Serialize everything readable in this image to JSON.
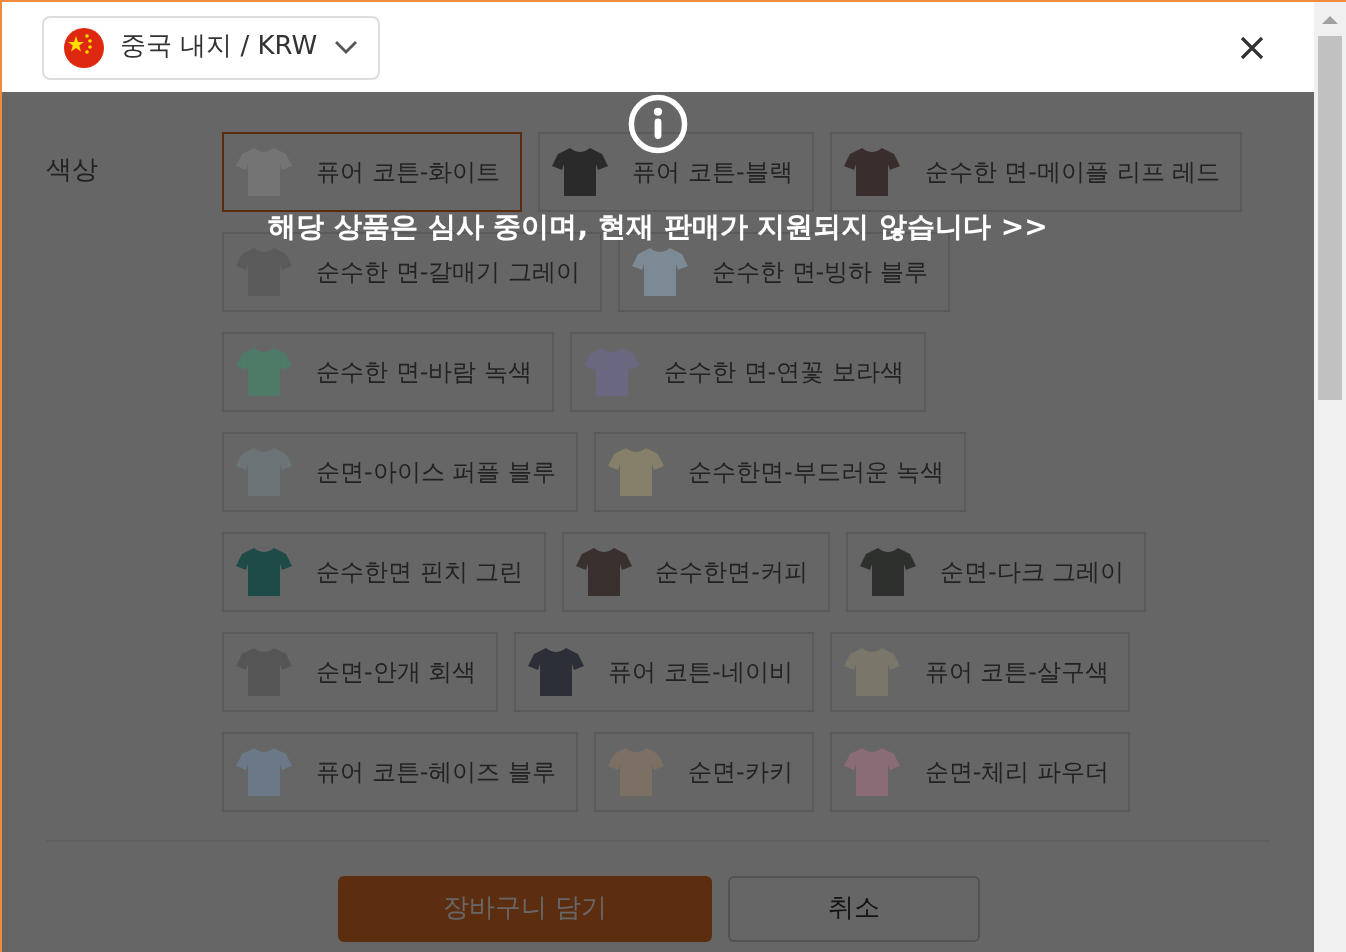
{
  "header": {
    "region_selector": {
      "label": "중국 내지 / KRW"
    }
  },
  "color_option": {
    "label": "색상",
    "swatches": [
      {
        "name": "퓨어 코튼-화이트",
        "color": "#747474",
        "selected": true
      },
      {
        "name": "퓨어 코튼-블랙",
        "color": "#2a2a2a",
        "selected": false
      },
      {
        "name": "순수한 면-메이플 리프 레드",
        "color": "#3a2e2c",
        "selected": false
      },
      {
        "name": "순수한 면-갈매기 그레이",
        "color": "#5a5a5a",
        "selected": false
      },
      {
        "name": "순수한 면-빙하 블루",
        "color": "#7c8a96",
        "selected": false
      },
      {
        "name": "순수한 면-바람 녹색",
        "color": "#4e7a68",
        "selected": false
      },
      {
        "name": "순수한 면-연꽃 보라색",
        "color": "#6a6880",
        "selected": false
      },
      {
        "name": "순면-아이스 퍼플 블루",
        "color": "#6c7478",
        "selected": false
      },
      {
        "name": "순수한면-부드러운 녹색",
        "color": "#86806a",
        "selected": false
      },
      {
        "name": "순수한면 핀치 그린",
        "color": "#1e4a48",
        "selected": false
      },
      {
        "name": "순수한면-커피",
        "color": "#3a302e",
        "selected": false
      },
      {
        "name": "순면-다크 그레이",
        "color": "#2e302e",
        "selected": false
      },
      {
        "name": "순면-안개 회색",
        "color": "#555555",
        "selected": false
      },
      {
        "name": "퓨어 코튼-네이비",
        "color": "#2c2e38",
        "selected": false
      },
      {
        "name": "퓨어 코튼-살구색",
        "color": "#7a766a",
        "selected": false
      },
      {
        "name": "퓨어 코튼-헤이즈 블루",
        "color": "#6a7888",
        "selected": false
      },
      {
        "name": "순면-카키",
        "color": "#7c7064",
        "selected": false
      },
      {
        "name": "순면-체리 파우더",
        "color": "#8a6c76",
        "selected": false
      }
    ]
  },
  "buttons": [
    {
      "label": "장바구니 담기",
      "kind": "primary"
    },
    {
      "label": "취소",
      "kind": "secondary"
    }
  ],
  "notice": {
    "message": "해당 상품은 심사 중이며, 현재 판매가 지원되지 않습니다 >>"
  }
}
